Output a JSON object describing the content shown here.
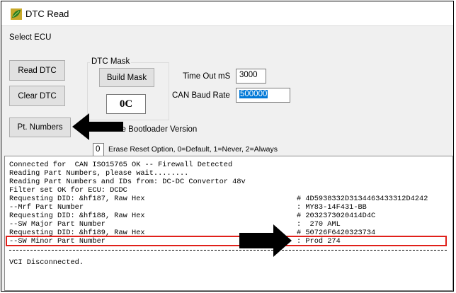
{
  "window": {
    "title": "DTC Read",
    "icon": "ecu-leaf-icon"
  },
  "select_ecu_label": "Select ECU",
  "buttons": {
    "read_dtc": "Read DTC",
    "clear_dtc": "Clear DTC",
    "pt_numbers": "Pt. Numbers",
    "build_mask": "Build Mask"
  },
  "dtc_mask": {
    "group_label": "DTC Mask",
    "value": "0C"
  },
  "timeout": {
    "label": "Time Out mS",
    "value": "3000"
  },
  "can_baud": {
    "label": "CAN Baud Rate",
    "value": "500000"
  },
  "bootloader_label": "le Bootloader Version",
  "erase": {
    "value": "0",
    "label": "Erase Reset Option, 0=Default, 1=Never, 2=Always"
  },
  "log": {
    "lines": [
      "Connected for  CAN ISO15765 OK -- Firewall Detected",
      "Reading Part Numbers, please wait........",
      "Reading Part Numbers and IDs from: DC-DC Convertor 48v",
      "Filter set OK for ECU: DCDC",
      "Requesting DID: &hf187, Raw Hex",
      "--Mrf Part Number",
      "Requesting DID: &hf188, Raw Hex",
      "--SW Major Part Number",
      "Requesting DID: &hf189, Raw Hex",
      "--SW Minor Part Number"
    ],
    "values": [
      "# 4D5938332D3134463433312D4242",
      ": MY83-14F431-BB",
      "# 2032373020414D4C",
      ":  270 AML",
      "# 50726F6420323734",
      ": Prod 274"
    ],
    "footer": "VCI Disconnected."
  },
  "colors": {
    "highlight": "#e0201a",
    "selection": "#0078d7",
    "arrow": "#000000"
  }
}
